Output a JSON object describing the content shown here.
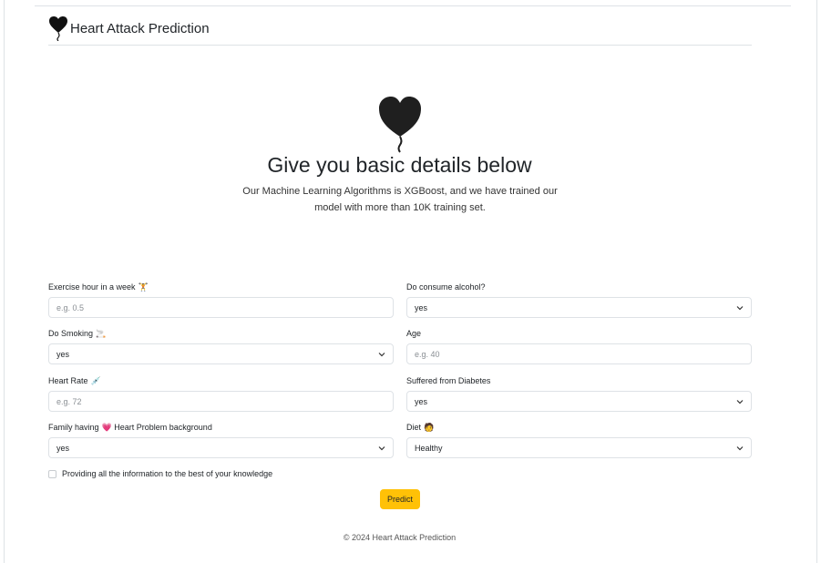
{
  "header": {
    "brand": "Heart Attack Prediction"
  },
  "hero": {
    "title": "Give you basic details below",
    "lead": "Our Machine Learning Algorithms is XGBoost, and we have trained our model with more than 10K training set."
  },
  "form": {
    "exercise": {
      "label": "Exercise hour in a week",
      "emoji": "🏋",
      "placeholder": "e.g. 0.5"
    },
    "alcohol": {
      "label": "Do consume alcohol?",
      "value": "yes"
    },
    "smoking": {
      "label": "Do Smoking",
      "emoji": "🚬",
      "value": "yes"
    },
    "age": {
      "label": "Age",
      "placeholder": "e.g. 40"
    },
    "heart_rate": {
      "label": "Heart Rate",
      "emoji": "💉",
      "placeholder": "e.g. 72"
    },
    "diabetes": {
      "label": "Suffered from Diabetes",
      "value": "yes"
    },
    "family": {
      "label_pre": "Family having",
      "emoji": "💗",
      "label_post": "Heart Problem background",
      "value": "yes"
    },
    "diet": {
      "label": "Diet",
      "emoji": "🧑",
      "value": "Healthy"
    },
    "consent": "Providing all the information to the best of your knowledge",
    "submit": "Predict"
  },
  "footer": {
    "text": "© 2024 Heart Attack Prediction"
  },
  "colors": {
    "accent": "#ffc107",
    "border": "#dee2e6"
  },
  "icons": {
    "brand": "heart-balloon-icon",
    "hero": "heart-balloon-icon",
    "select": "chevron-down-icon"
  }
}
